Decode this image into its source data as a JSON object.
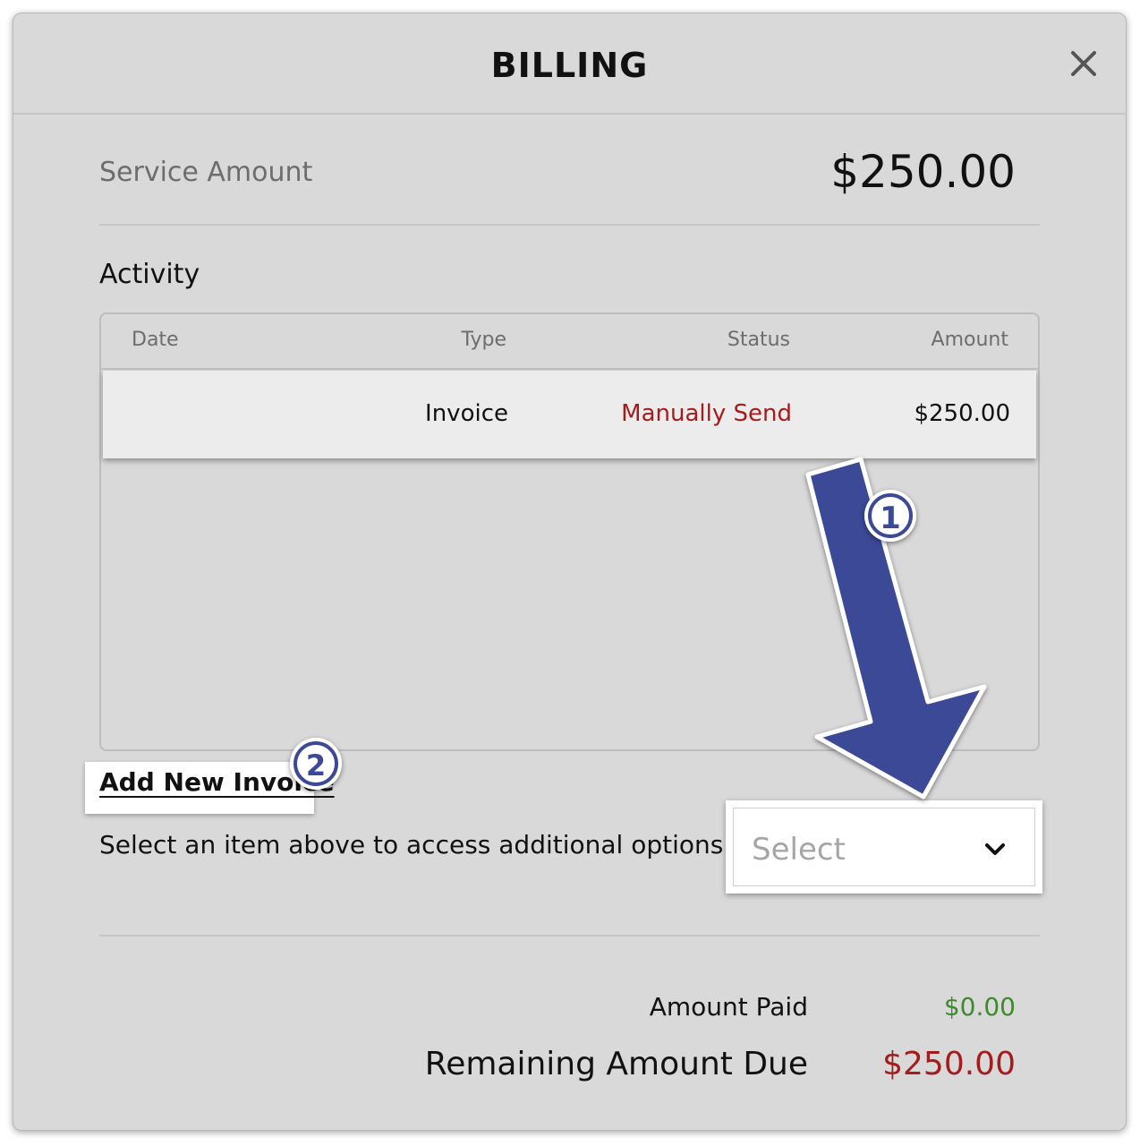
{
  "header": {
    "title": "BILLING"
  },
  "service": {
    "label": "Service Amount",
    "amount": "$250.00"
  },
  "activity": {
    "heading": "Activity",
    "columns": {
      "date": "Date",
      "type": "Type",
      "status": "Status",
      "amount": "Amount"
    },
    "rows": [
      {
        "date": "",
        "type": "Invoice",
        "status": "Manually Send",
        "amount": "$250.00"
      }
    ]
  },
  "actions": {
    "add_invoice_label": "Add New Invoice",
    "hint": "Select an item above to access additional options",
    "select_placeholder": "Select"
  },
  "totals": {
    "amount_paid_label": "Amount Paid",
    "amount_paid_value": "$0.00",
    "remaining_label": "Remaining Amount Due",
    "remaining_value": "$250.00"
  },
  "annotations": {
    "step1": "1",
    "step2": "2"
  },
  "colors": {
    "status_red": "#a51c1c",
    "paid_green": "#3d8b2a",
    "annotation_blue": "#3b4a96"
  }
}
